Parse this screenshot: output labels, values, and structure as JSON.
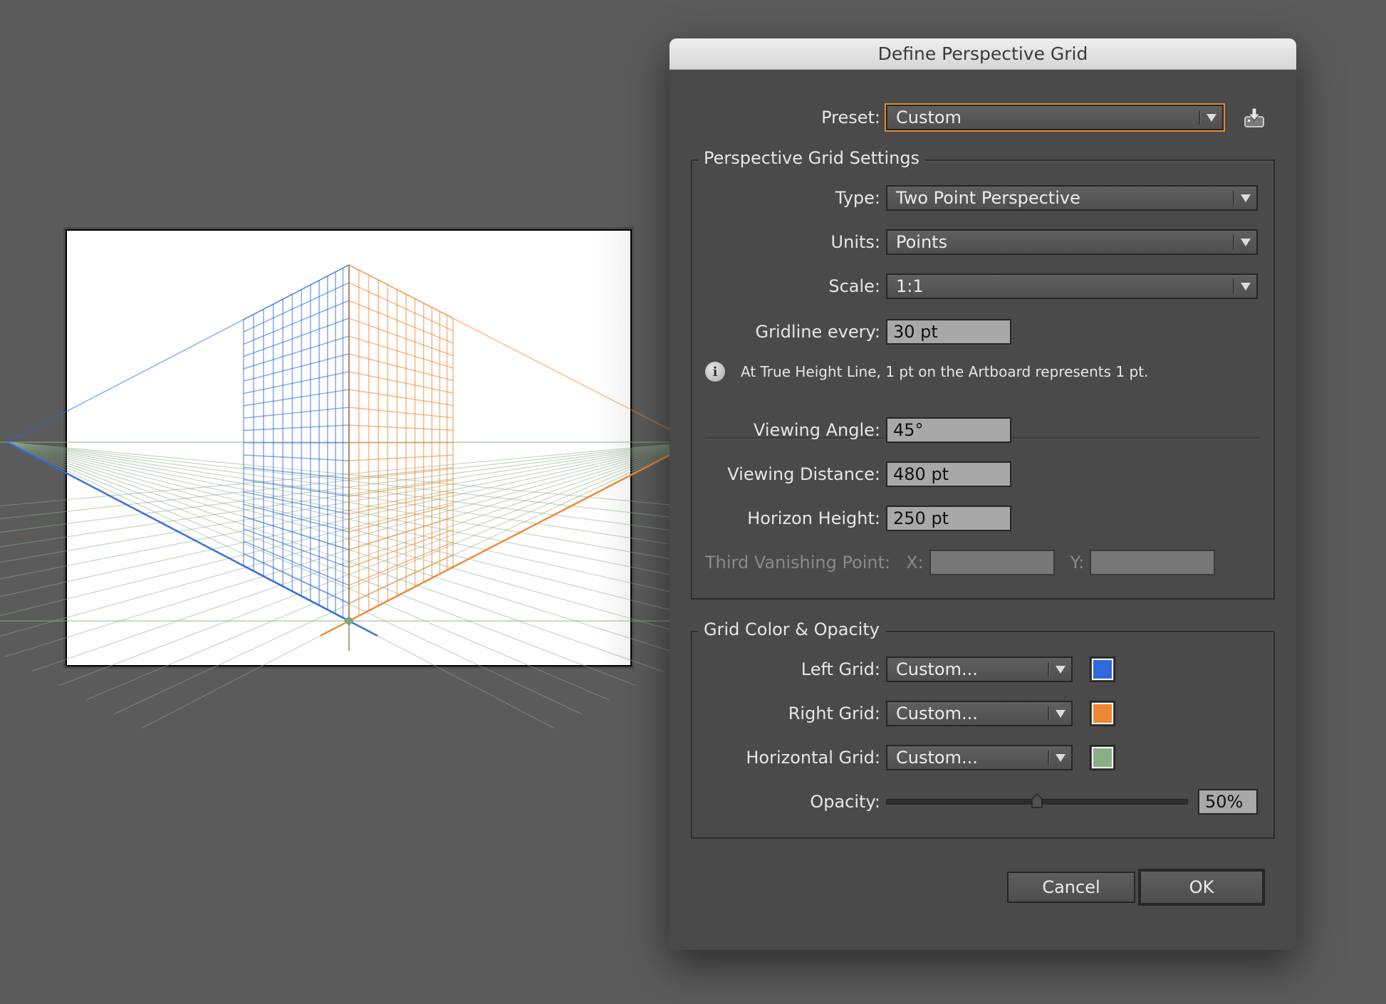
{
  "dialog": {
    "title": "Define Perspective Grid",
    "preset": {
      "label": "Preset:",
      "value": "Custom",
      "export_icon": "export-preset-icon"
    },
    "settings_group": {
      "title": "Perspective Grid Settings",
      "type": {
        "label": "Type:",
        "value": "Two Point Perspective"
      },
      "units": {
        "label": "Units:",
        "value": "Points"
      },
      "scale": {
        "label": "Scale:",
        "value": "1:1"
      },
      "gridline_every": {
        "label": "Gridline every:",
        "value": "30 pt"
      },
      "info_text": "At True Height Line, 1 pt on the Artboard represents 1 pt.",
      "viewing_angle": {
        "label": "Viewing Angle:",
        "value": "45°"
      },
      "viewing_distance": {
        "label": "Viewing Distance:",
        "value": "480 pt"
      },
      "horizon_height": {
        "label": "Horizon Height:",
        "value": "250 pt"
      },
      "third_vp": {
        "label": "Third Vanishing Point:",
        "x_label": "X:",
        "y_label": "Y:",
        "x_value": "",
        "y_value": "",
        "disabled": true
      }
    },
    "color_group": {
      "title": "Grid Color & Opacity",
      "left_grid": {
        "label": "Left Grid:",
        "value": "Custom...",
        "color": "#2f67de"
      },
      "right_grid": {
        "label": "Right Grid:",
        "value": "Custom...",
        "color": "#ef8632"
      },
      "horizontal_grid": {
        "label": "Horizontal Grid:",
        "value": "Custom...",
        "color": "#8aae86"
      },
      "opacity": {
        "label": "Opacity:",
        "value": "50%",
        "fraction": 0.5
      }
    },
    "buttons": {
      "cancel": "Cancel",
      "ok": "OK"
    }
  },
  "artboard": {
    "grid_type": "two-point",
    "left_color": "#2f67de",
    "right_color": "#ef8632",
    "horizontal_color": "#8aae86",
    "opacity": 0.5,
    "left_cells": 12,
    "right_cells": 12,
    "height_cells": 20,
    "ground_cells": 14
  }
}
